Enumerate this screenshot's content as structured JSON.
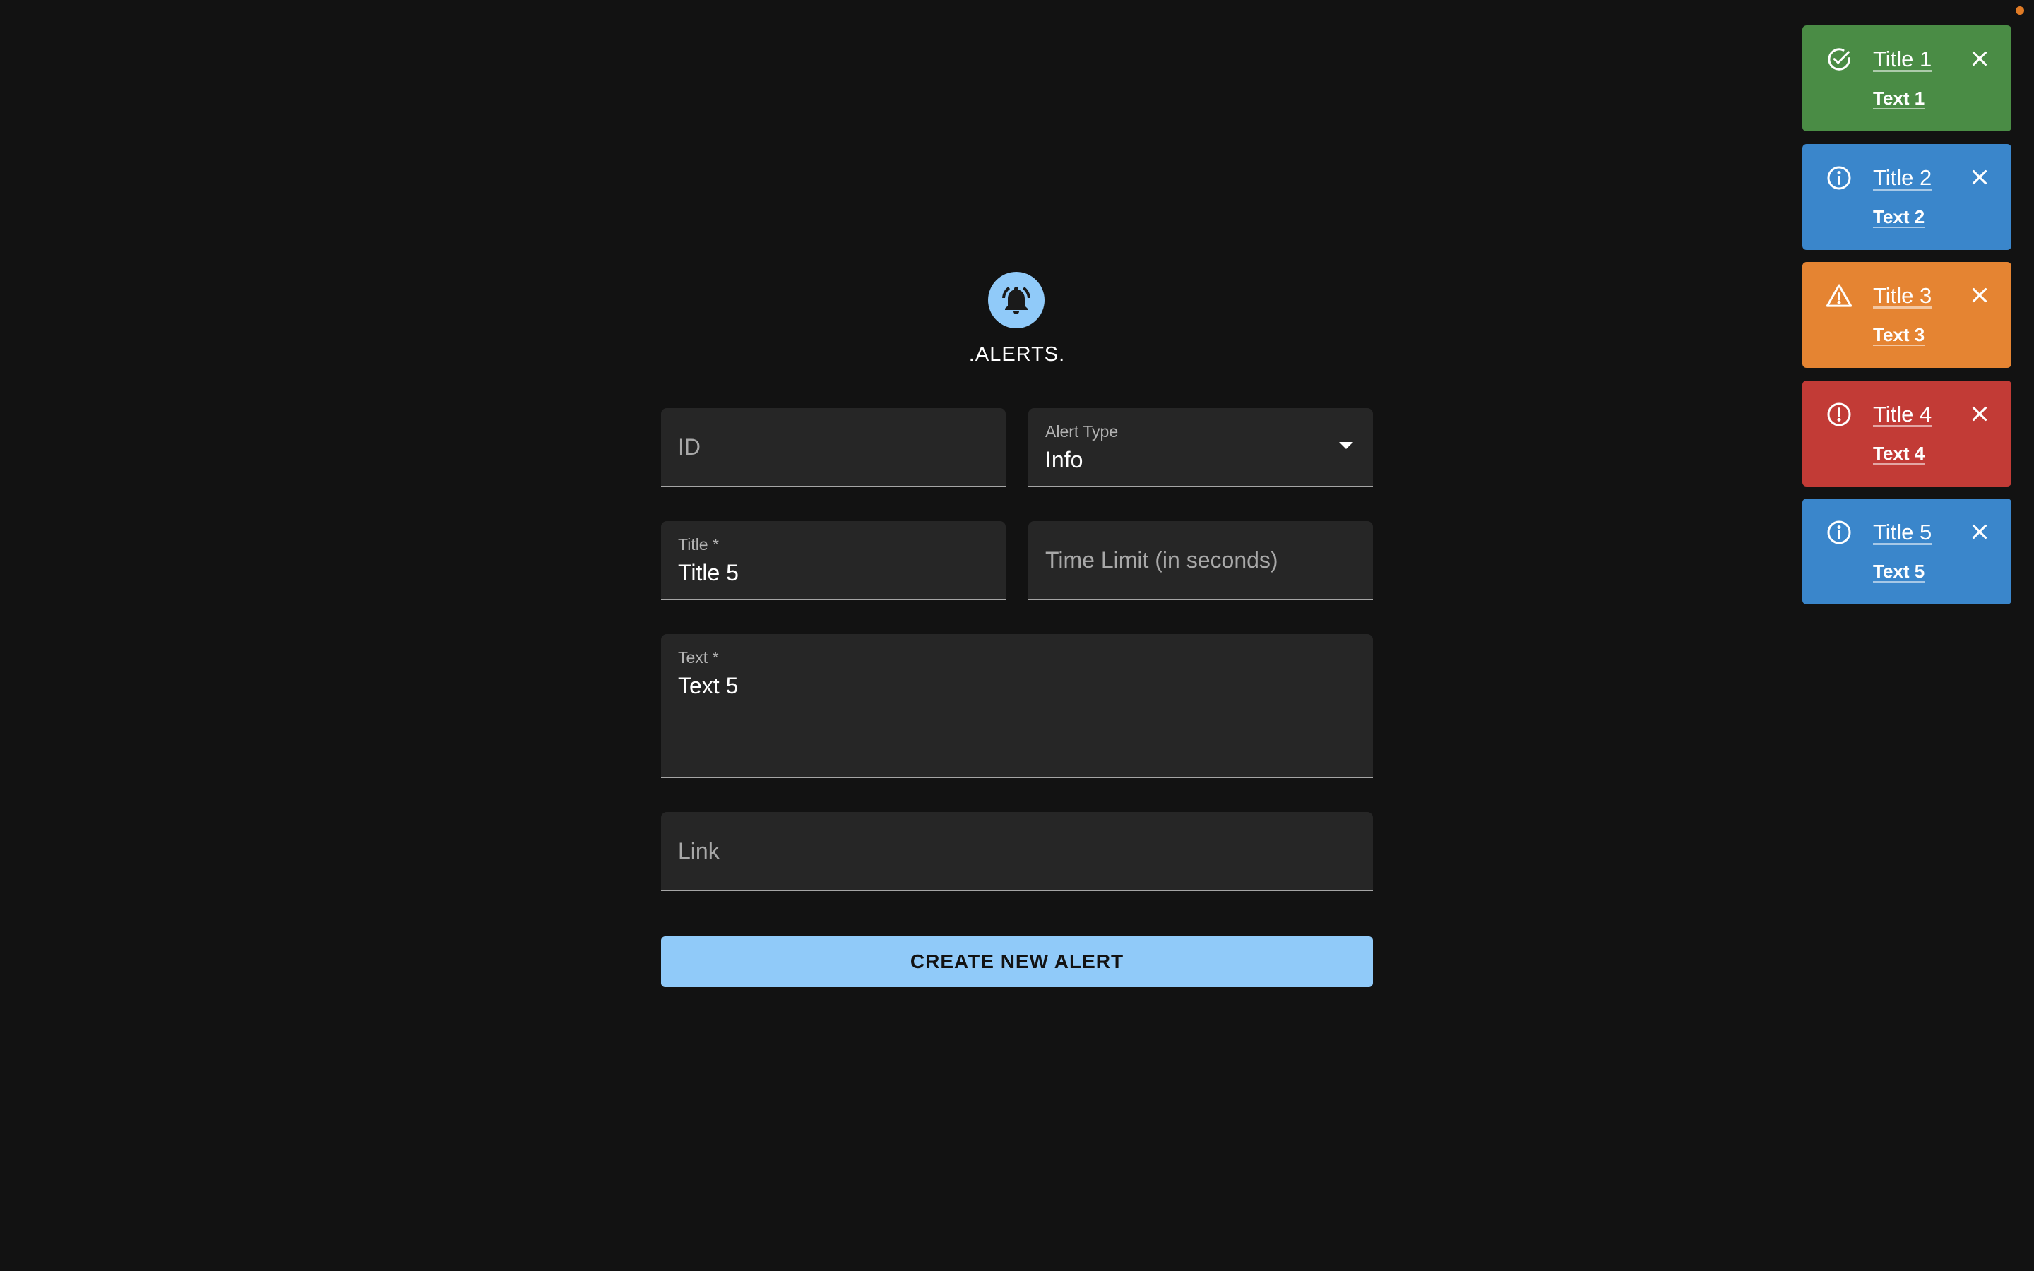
{
  "app": {
    "title": ".ALERTS."
  },
  "form": {
    "id_field": {
      "placeholder": "ID"
    },
    "alert_type": {
      "label": "Alert Type",
      "value": "Info"
    },
    "title_field": {
      "label": "Title *",
      "value": "Title 5"
    },
    "time_limit_field": {
      "placeholder": "Time Limit (in seconds)"
    },
    "text_field": {
      "label": "Text *",
      "value": "Text 5"
    },
    "link_field": {
      "placeholder": "Link"
    },
    "submit_label": "CREATE NEW ALERT"
  },
  "alerts": [
    {
      "title": "Title 1",
      "text": "Text 1",
      "type": "success",
      "color": "#4a8c45",
      "icon": "check-circle-icon"
    },
    {
      "title": "Title 2",
      "text": "Text 2",
      "type": "info",
      "color": "#3a86cb",
      "icon": "info-circle-icon"
    },
    {
      "title": "Title 3",
      "text": "Text 3",
      "type": "warning",
      "color": "#e58432",
      "icon": "warning-triangle-icon"
    },
    {
      "title": "Title 4",
      "text": "Text 4",
      "type": "error",
      "color": "#c23b36",
      "icon": "error-circle-icon"
    },
    {
      "title": "Title 5",
      "text": "Text 5",
      "type": "info",
      "color": "#3a86cb",
      "icon": "info-circle-icon"
    }
  ],
  "colors": {
    "background": "#121212",
    "field": "#262626",
    "accent": "#90caf9",
    "status_dot": "#e07b25"
  }
}
